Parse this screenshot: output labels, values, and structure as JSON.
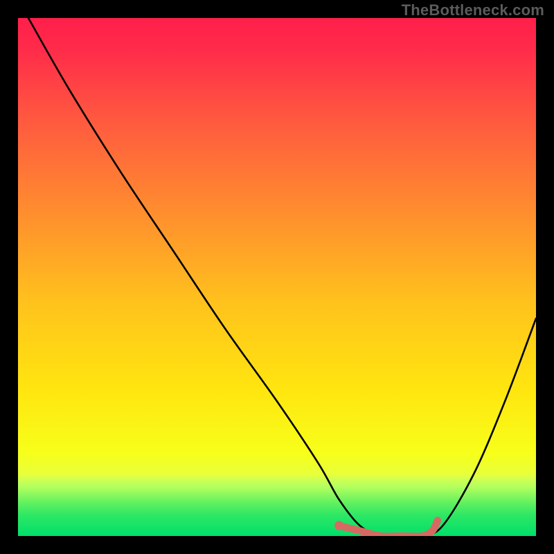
{
  "watermark": "TheBottleneck.com",
  "chart_data": {
    "type": "line",
    "title": "",
    "xlabel": "",
    "ylabel": "",
    "xlim": [
      0,
      100
    ],
    "ylim": [
      0,
      100
    ],
    "grid": false,
    "background_gradient": {
      "top_color": "#ff1f4b",
      "mid_color": "#ffd400",
      "bottom_band_color": "#00e06a",
      "bottom_band_start_pct": 88
    },
    "series": [
      {
        "name": "bottleneck-curve",
        "color": "#000000",
        "x": [
          2,
          10,
          20,
          30,
          40,
          50,
          58,
          62,
          66,
          70,
          74,
          78,
          82,
          88,
          94,
          100
        ],
        "values": [
          100,
          86,
          70,
          55,
          40,
          26,
          14,
          7,
          2,
          0,
          0,
          0,
          2,
          12,
          26,
          42
        ]
      }
    ],
    "highlight_segment": {
      "name": "optimal-range-marker",
      "color": "#d66a63",
      "x": [
        62,
        66,
        70,
        74,
        78,
        80,
        81
      ],
      "values": [
        2,
        1,
        0,
        0,
        0,
        1,
        3
      ],
      "endpoint_dot": {
        "x": 62,
        "y": 2
      }
    }
  }
}
